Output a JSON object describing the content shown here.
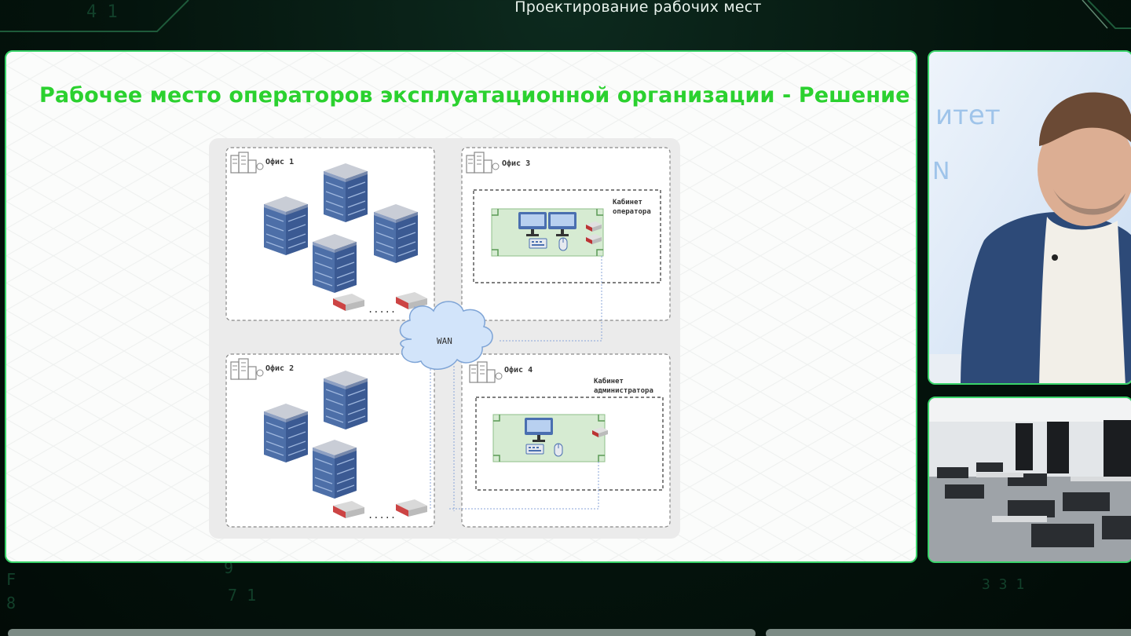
{
  "header": {
    "title": "Проектирование рабочих мест"
  },
  "slide": {
    "title": "Рабочее место операторов эксплуатационной организации - Решение",
    "diagram": {
      "offices": [
        {
          "label": "Офис 1"
        },
        {
          "label": "Офис 2"
        },
        {
          "label": "Офис 3"
        },
        {
          "label": "Офис 4"
        }
      ],
      "rooms": [
        {
          "label_line1": "Кабинет",
          "label_line2": "оператора"
        },
        {
          "label_line1": "Кабинет",
          "label_line2": "администратора"
        }
      ],
      "cloud_label": "WAN",
      "dots": "....."
    }
  },
  "panels": {
    "speaker_backdrop_text": "итет",
    "speaker_backdrop_letter": "N"
  },
  "colors": {
    "accent_green": "#2bd12f",
    "frame_green": "#39d46a",
    "desk_fill": "#d6ebd2",
    "server_blue": "#4a6fb0"
  }
}
